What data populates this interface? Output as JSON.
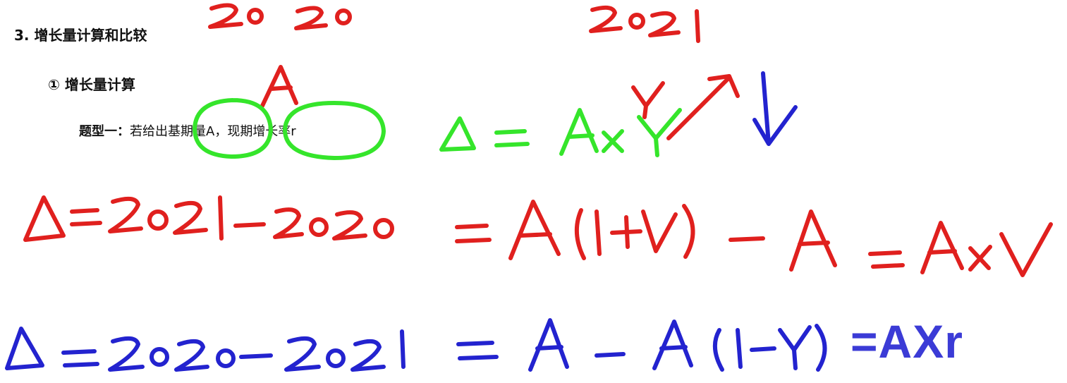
{
  "slide": {
    "section_title": "3. 增长量计算和比较",
    "subsection_title": "① 增长量计算",
    "question_type_label": "题型一：",
    "question_text": "若给出基期量A，现期增长率r"
  },
  "annotations": {
    "year_base": "2020",
    "year_current": "2021",
    "label_A": "A",
    "formula_green": "Δ = A×Y",
    "formula_red": "Δ = 2021 − 2020 = A(1+Y) − A = A×Y",
    "formula_blue": "Δ = 2020 − 2021 = A − A(1−Y)",
    "result_text": "=AXr"
  },
  "colors": {
    "ink_red": "#e0201e",
    "ink_green": "#35e52b",
    "ink_blue": "#2323cf",
    "result_blue": "#3b3bd6"
  }
}
